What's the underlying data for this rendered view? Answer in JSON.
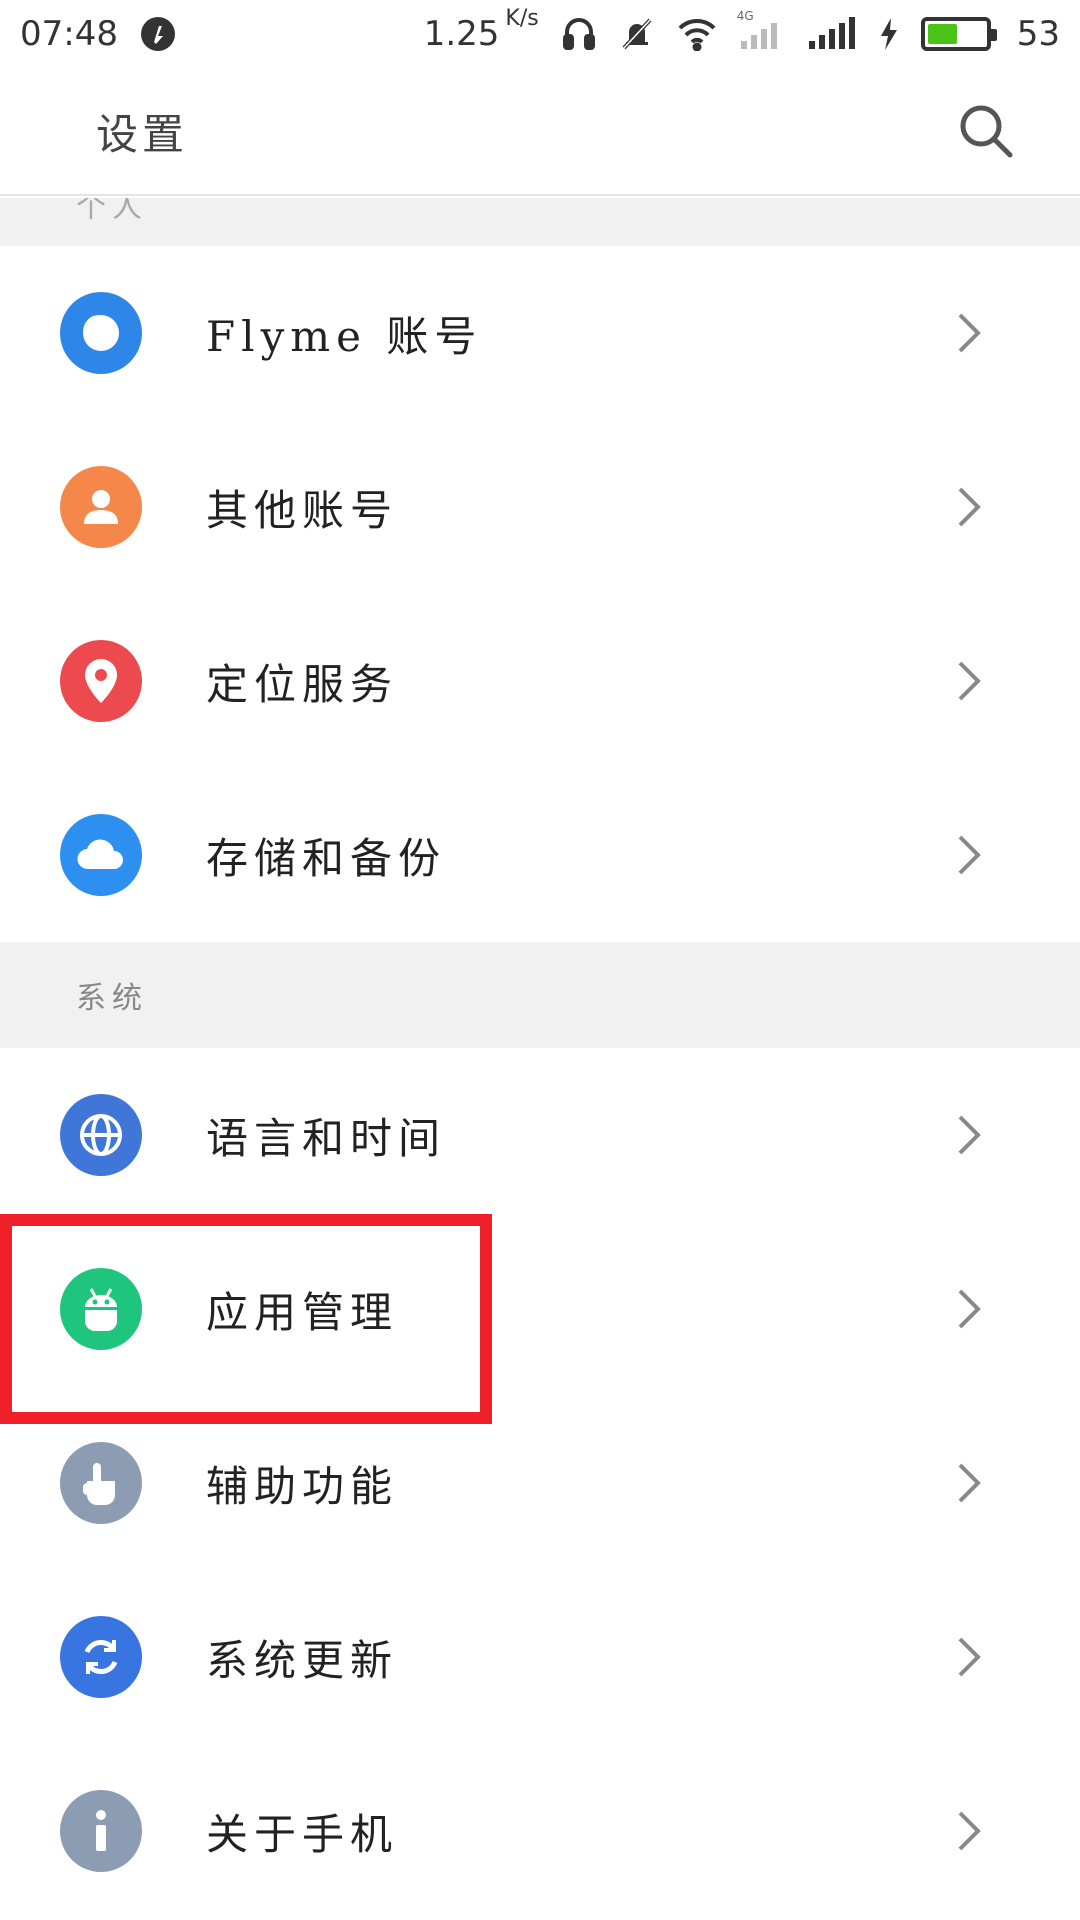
{
  "status_bar": {
    "time": "07:48",
    "net_speed": "1.25",
    "net_unit": "K/s",
    "signal_tag": "4G",
    "battery_level": "53",
    "battery_color": "#4cc417"
  },
  "header": {
    "title": "设置",
    "search_icon": "search-icon"
  },
  "sections": {
    "personal": {
      "label": "个人",
      "items": [
        {
          "label": "Flyme 账号",
          "icon": "flyme-account-icon",
          "color": "#2d86e8"
        },
        {
          "label": "其他账号",
          "icon": "person-icon",
          "color": "#f5874a"
        },
        {
          "label": "定位服务",
          "icon": "location-pin-icon",
          "color": "#ec4a4f"
        },
        {
          "label": "存储和备份",
          "icon": "cloud-icon",
          "color": "#2d8ff0"
        }
      ]
    },
    "system": {
      "label": "系统",
      "items": [
        {
          "label": "语言和时间",
          "icon": "globe-icon",
          "color": "#3f76d8"
        },
        {
          "label": "应用管理",
          "icon": "android-icon",
          "color": "#1fc47d"
        },
        {
          "label": "辅助功能",
          "icon": "hand-pointer-icon",
          "color": "#8b9cb3"
        },
        {
          "label": "系统更新",
          "icon": "refresh-icon",
          "color": "#3875e0"
        },
        {
          "label": "关于手机",
          "icon": "info-icon",
          "color": "#8b9cb3"
        }
      ]
    }
  },
  "highlight_color": "#f0202a"
}
